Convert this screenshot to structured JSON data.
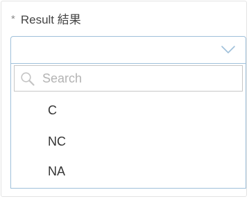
{
  "field": {
    "required_mark": "*",
    "label": "Result 結果"
  },
  "select": {
    "selected_value": ""
  },
  "dropdown": {
    "search_placeholder": "Search",
    "search_value": "",
    "options": [
      {
        "label": "C"
      },
      {
        "label": "NC"
      },
      {
        "label": "NA"
      }
    ]
  },
  "colors": {
    "focus_border": "#9fc0da",
    "placeholder": "#b3b3b3",
    "text": "#333333"
  }
}
